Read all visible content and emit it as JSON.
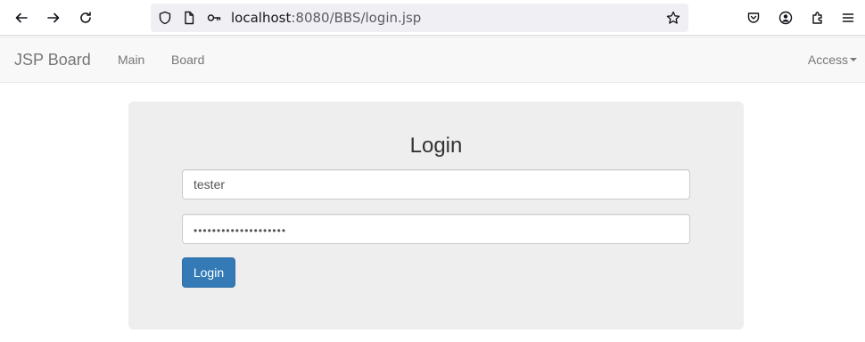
{
  "browser": {
    "url_host": "localhost",
    "url_rest": ":8080/BBS/login.jsp"
  },
  "navbar": {
    "brand": "JSP Board",
    "links": [
      "Main",
      "Board"
    ],
    "dropdown_label": "Access"
  },
  "login": {
    "title": "Login",
    "username_value": "tester",
    "password_value": "••••••••••••••••••••",
    "submit_label": "Login"
  },
  "colors": {
    "primary": "#337ab7",
    "navbar_bg": "#f8f8f8",
    "jumbotron_bg": "#eeeeee"
  }
}
